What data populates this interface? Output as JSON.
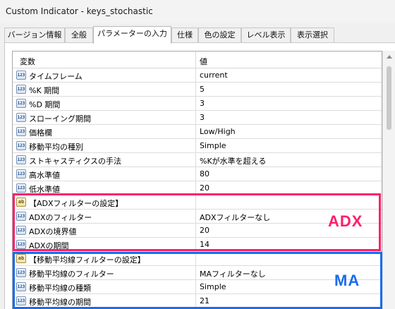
{
  "window": {
    "title": "Custom Indicator - keys_stochastic"
  },
  "tabs": [
    {
      "label": "バージョン情報"
    },
    {
      "label": "全般"
    },
    {
      "label": "パラメーターの入力"
    },
    {
      "label": "仕様"
    },
    {
      "label": "色の設定"
    },
    {
      "label": "レベル表示"
    },
    {
      "label": "表示選択"
    }
  ],
  "active_tab_index": 2,
  "grid": {
    "headers": {
      "name": "変数",
      "value": "値"
    },
    "rows": [
      {
        "icon": "123",
        "name": "タイムフレーム",
        "value": "current"
      },
      {
        "icon": "123",
        "name": "%K 期間",
        "value": "5"
      },
      {
        "icon": "123",
        "name": "%D 期間",
        "value": "3"
      },
      {
        "icon": "123",
        "name": "スローイング期間",
        "value": "3"
      },
      {
        "icon": "123",
        "name": "価格欄",
        "value": "Low/High"
      },
      {
        "icon": "123",
        "name": "移動平均の種別",
        "value": "Simple"
      },
      {
        "icon": "123",
        "name": "ストキャスティクスの手法",
        "value": "%Kが水準を超える"
      },
      {
        "icon": "123",
        "name": "高水準値",
        "value": "80"
      },
      {
        "icon": "123",
        "name": "低水準値",
        "value": "20"
      },
      {
        "icon": "ab",
        "name": "【ADXフィルターの設定】",
        "value": ""
      },
      {
        "icon": "123",
        "name": "ADXのフィルター",
        "value": "ADXフィルターなし"
      },
      {
        "icon": "123",
        "name": "ADXの境界値",
        "value": "20"
      },
      {
        "icon": "123",
        "name": "ADXの期間",
        "value": "14"
      },
      {
        "icon": "ab",
        "name": "【移動平均線フィルターの設定】",
        "value": ""
      },
      {
        "icon": "123",
        "name": "移動平均線のフィルター",
        "value": "MAフィルターなし"
      },
      {
        "icon": "123",
        "name": "移動平均線の種類",
        "value": "Simple"
      },
      {
        "icon": "123",
        "name": "移動平均線の期間",
        "value": "21"
      }
    ]
  },
  "annotations": {
    "adx": {
      "label": "ADX",
      "color": "#ff1f6a"
    },
    "ma": {
      "label": "MA",
      "color": "#1a6cf0"
    }
  },
  "icons": {
    "int": "integer-type-icon",
    "str": "string-type-icon"
  }
}
